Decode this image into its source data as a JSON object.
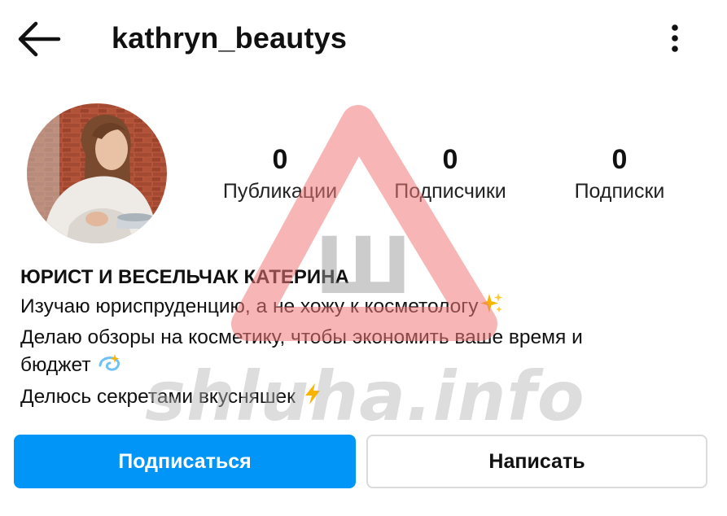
{
  "header": {
    "username": "kathryn_beautys",
    "back_icon": "arrow-left-icon",
    "menu_icon": "more-vertical-icon"
  },
  "profile": {
    "avatar_icon": "profile-photo",
    "stats": [
      {
        "value": "0",
        "label": "Публикации"
      },
      {
        "value": "0",
        "label": "Подписчики"
      },
      {
        "value": "0",
        "label": "Подписки"
      }
    ]
  },
  "bio": {
    "name": "ЮРИСТ И ВЕСЕЛЬЧАК КАТЕРИНА",
    "lines": [
      "Изучаю юриспруденцию, а не хожу к косметологу",
      "Делаю обзоры на косметику, чтобы экономить ваше время и",
      "бюджет",
      "Делюсь секретами вкусняшек"
    ],
    "emojis": [
      "sparkles-icon",
      "dizzy-icon",
      "lightning-icon"
    ]
  },
  "actions": {
    "follow_label": "Подписаться",
    "message_label": "Написать"
  },
  "watermark": {
    "letter": "Ш",
    "text": "shluha.info"
  },
  "colors": {
    "accent": "#0095f6",
    "border": "#dbdbdb",
    "text": "#111111",
    "watermark_red": "#f07878"
  }
}
